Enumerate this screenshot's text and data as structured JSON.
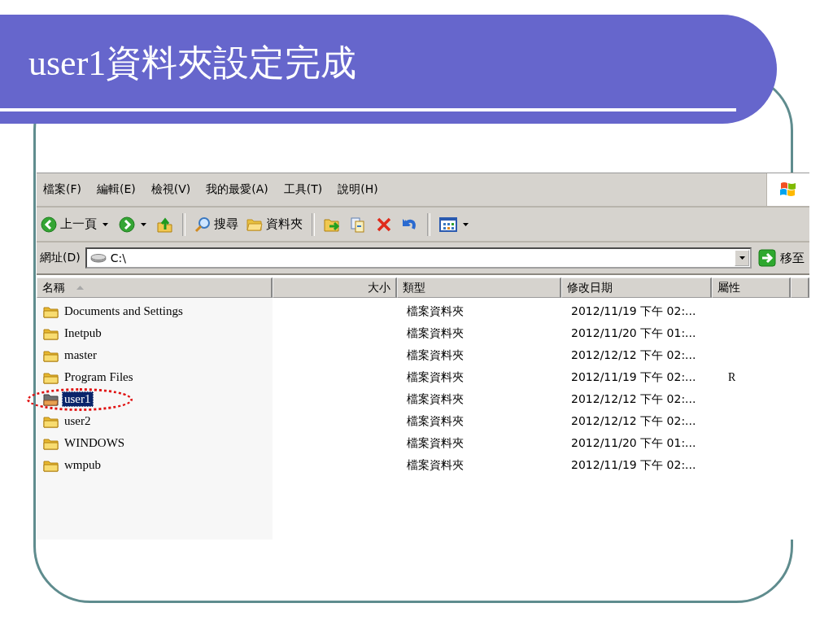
{
  "slide": {
    "title": "user1資料夾設定完成"
  },
  "menu": [
    {
      "label": "檔案(F)"
    },
    {
      "label": "編輯(E)"
    },
    {
      "label": "檢視(V)"
    },
    {
      "label": "我的最愛(A)"
    },
    {
      "label": "工具(T)"
    },
    {
      "label": "說明(H)"
    }
  ],
  "toolbar": [
    {
      "kind": "back",
      "label": "上一頁",
      "dropdown": true
    },
    {
      "kind": "forward",
      "dropdown": true
    },
    {
      "kind": "up"
    },
    {
      "kind": "separator"
    },
    {
      "kind": "search",
      "label": "搜尋"
    },
    {
      "kind": "folders",
      "label": "資料夾"
    },
    {
      "kind": "separator"
    },
    {
      "kind": "move"
    },
    {
      "kind": "copy"
    },
    {
      "kind": "delete"
    },
    {
      "kind": "undo"
    },
    {
      "kind": "separator"
    },
    {
      "kind": "views",
      "dropdown": true
    }
  ],
  "address": {
    "label": "網址(D)",
    "value": "C:\\",
    "go": "移至"
  },
  "table": {
    "columns": [
      {
        "label": "名稱",
        "sorted": true
      },
      {
        "label": "大小",
        "sorted": false
      },
      {
        "label": "類型",
        "sorted": false
      },
      {
        "label": "修改日期",
        "sorted": false
      },
      {
        "label": "屬性",
        "sorted": false
      }
    ],
    "rows": [
      {
        "name": "Documents and Settings",
        "type": "檔案資料夾",
        "modified": "2012/11/19 下午 02:...",
        "selected": false,
        "circled": false
      },
      {
        "name": "Inetpub",
        "type": "檔案資料夾",
        "modified": "2012/11/20 下午 01:...",
        "selected": false,
        "circled": false
      },
      {
        "name": "master",
        "type": "檔案資料夾",
        "modified": "2012/12/12 下午 02:...",
        "selected": false,
        "circled": false
      },
      {
        "name": "Program Files",
        "type": "檔案資料夾",
        "modified": "2012/11/19 下午 02:...",
        "attributes": "R",
        "selected": false,
        "circled": false
      },
      {
        "name": "user1",
        "type": "檔案資料夾",
        "modified": "2012/12/12 下午 02:...",
        "selected": true,
        "circled": true
      },
      {
        "name": "user2",
        "type": "檔案資料夾",
        "modified": "2012/12/12 下午 02:...",
        "selected": false,
        "circled": false
      },
      {
        "name": "WINDOWS",
        "type": "檔案資料夾",
        "modified": "2012/11/20 下午 01:...",
        "selected": false,
        "circled": false
      },
      {
        "name": "wmpub",
        "type": "檔案資料夾",
        "modified": "2012/11/19 下午 02:...",
        "selected": false,
        "circled": false
      }
    ]
  }
}
